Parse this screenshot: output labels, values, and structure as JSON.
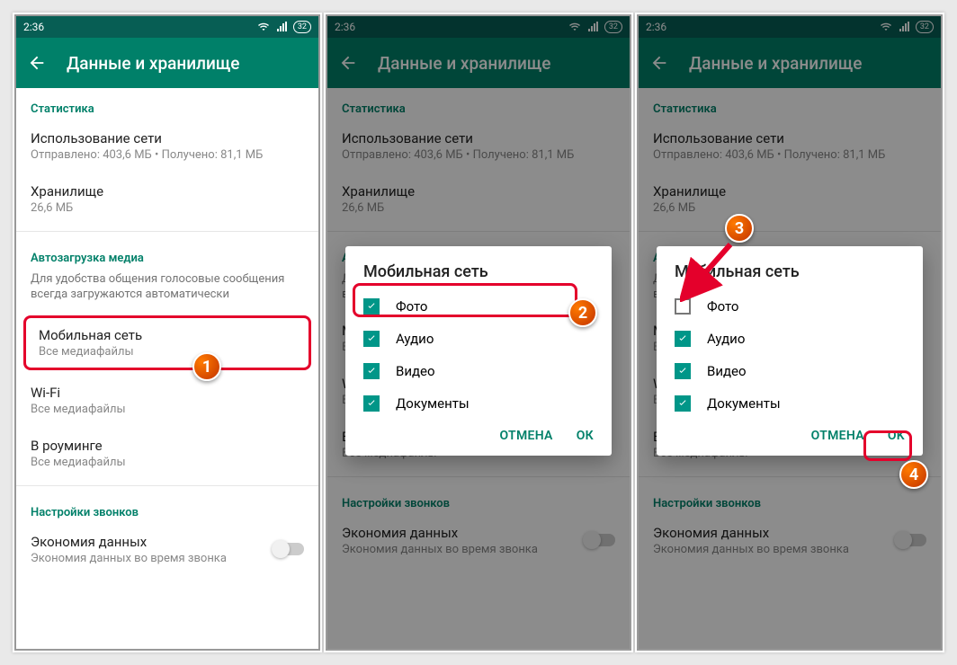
{
  "status": {
    "time": "2:36",
    "battery": "32"
  },
  "appbar": {
    "title": "Данные и хранилище"
  },
  "sections": {
    "stats_label": "Статистика",
    "network_usage_title": "Использование сети",
    "network_usage_sub": "Отправлено: 403,6 МБ • Получено: 81,1 МБ",
    "storage_title": "Хранилище",
    "storage_sub": "26,6 МБ",
    "autodownload_label": "Автозагрузка медиа",
    "autodownload_desc": "Для удобства общения голосовые сообщения всегда загружаются автоматически",
    "mobile_title": "Мобильная сеть",
    "mobile_sub": "Все медиафайлы",
    "wifi_title": "Wi-Fi",
    "wifi_sub": "Все медиафайлы",
    "roaming_title": "В роуминге",
    "roaming_sub": "Все медиафайлы",
    "calls_label": "Настройки звонков",
    "data_saver_title": "Экономия данных",
    "data_saver_sub": "Экономия данных во время звонка"
  },
  "dialog": {
    "title": "Мобильная сеть",
    "opt_photo": "Фото",
    "opt_audio": "Аудио",
    "opt_video": "Видео",
    "opt_docs": "Документы",
    "btn_cancel": "ОТМЕНА",
    "btn_ok": "ОК"
  },
  "markers": {
    "m1": "1",
    "m2": "2",
    "m3": "3",
    "m4": "4"
  },
  "ok_en": "OK"
}
